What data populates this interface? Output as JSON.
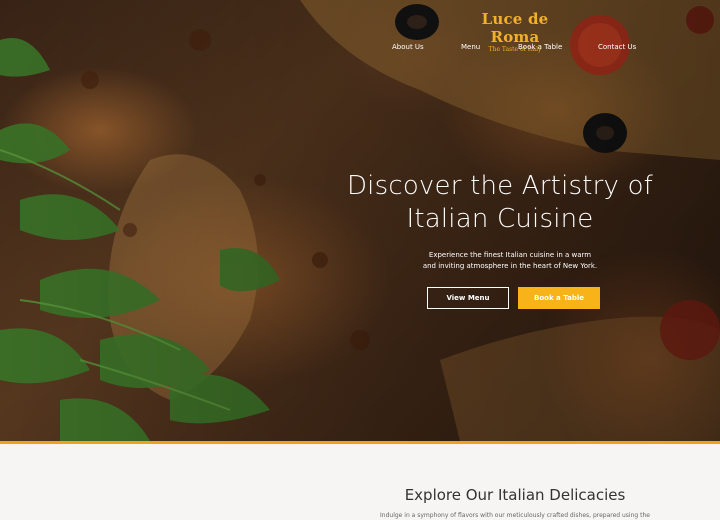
{
  "brand": {
    "name": "Luce de Roma",
    "tagline": "The Taste of Italy"
  },
  "nav": {
    "items": [
      {
        "label": "About Us"
      },
      {
        "label": "Menu"
      },
      {
        "label": "Book a Table"
      },
      {
        "label": "Contact Us"
      }
    ]
  },
  "hero": {
    "title_line1": "Discover the Artistry of",
    "title_line2": "Italian Cuisine",
    "subtitle_line1": "Experience the finest Italian cuisine in a warm",
    "subtitle_line2": "and inviting atmosphere in the heart of New York.",
    "primary_button": "View Menu",
    "secondary_button": "Book a Table",
    "image_description": "pizza-with-arugula-photo"
  },
  "section": {
    "title": "Explore Our Italian Delicacies",
    "text": "Indulge in a symphony of flavors with our meticulously crafted dishes, prepared using the"
  },
  "colors": {
    "accent": "#f7b317",
    "brand": "#f3b12a",
    "divider": "#f0a01f"
  }
}
